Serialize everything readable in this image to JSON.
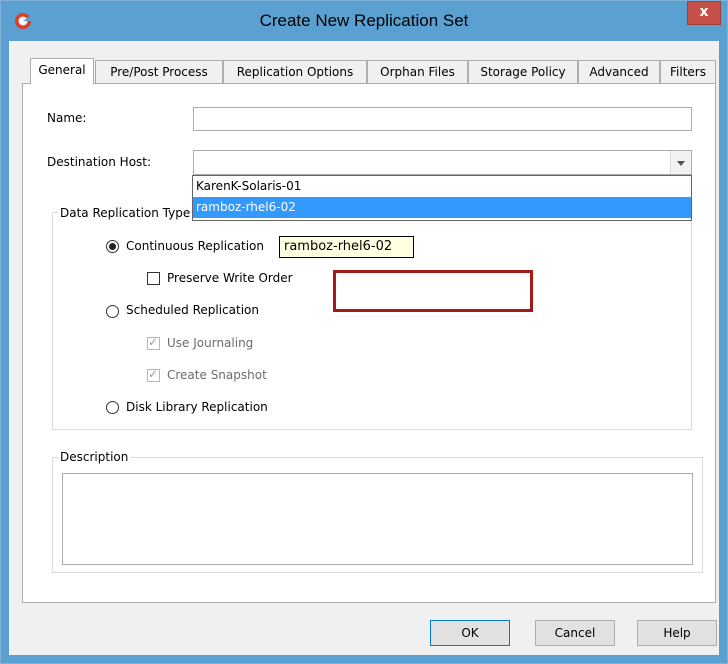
{
  "window": {
    "title": "Create New Replication Set",
    "close_glyph": "x",
    "app_icon": "commvault-logo-icon"
  },
  "tabs": [
    {
      "label": "General",
      "active": true
    },
    {
      "label": "Pre/Post Process",
      "active": false
    },
    {
      "label": "Replication Options",
      "active": false
    },
    {
      "label": "Orphan Files",
      "active": false
    },
    {
      "label": "Storage Policy",
      "active": false
    },
    {
      "label": "Advanced",
      "active": false
    },
    {
      "label": "Filters",
      "active": false
    }
  ],
  "general": {
    "name_label": "Name:",
    "name_value": "",
    "destination_label": "Destination Host:",
    "destination_value": "",
    "destination_options": [
      "KarenK-Solaris-01",
      "ramboz-rhel6-02"
    ],
    "destination_highlighted": "ramboz-rhel6-02",
    "replication_group_title": "Data Replication Type",
    "options": {
      "continuous": {
        "label": "Continuous Replication",
        "selected": true
      },
      "preserve_write_order": {
        "label": "Preserve Write Order",
        "checked": false
      },
      "scheduled": {
        "label": "Scheduled Replication",
        "selected": false
      },
      "use_journaling": {
        "label": "Use Journaling",
        "checked": true,
        "disabled": true
      },
      "create_snapshot": {
        "label": "Create Snapshot",
        "checked": true,
        "disabled": true
      },
      "disk_library": {
        "label": "Disk Library Replication",
        "selected": false
      }
    },
    "tooltip": "ramboz-rhel6-02",
    "description_title": "Description",
    "description_value": ""
  },
  "buttons": {
    "ok": "OK",
    "cancel": "Cancel",
    "help": "Help"
  },
  "colors": {
    "titlebar": "#5aa0d0",
    "selection": "#3399ff",
    "annotation": "#a31a1a",
    "close": "#c7504a"
  }
}
